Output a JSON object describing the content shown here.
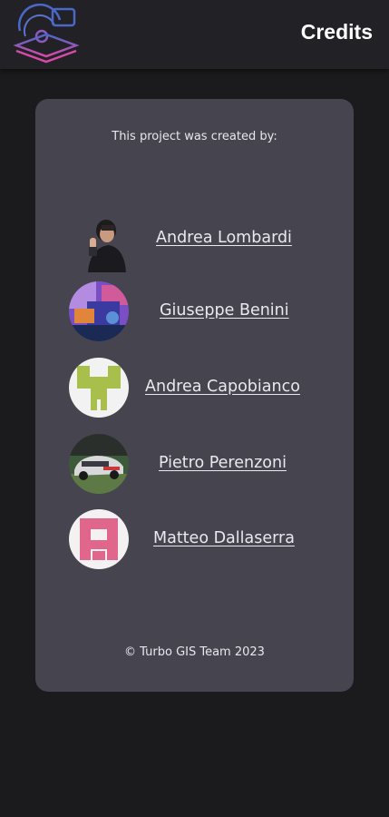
{
  "header": {
    "title": "Credits",
    "logo_icon": "turbo-gis-logo-icon"
  },
  "card": {
    "intro": "This project was created by:",
    "members": [
      {
        "name": "Andrea Lombardi",
        "avatar": "photo-avatar-icon"
      },
      {
        "name": "Giuseppe Benini",
        "avatar": "colorful-photo-avatar-icon"
      },
      {
        "name": "Andrea Capobianco",
        "avatar": "green-pixel-identicon-icon"
      },
      {
        "name": "Pietro Perenzoni",
        "avatar": "car-photo-avatar-icon"
      },
      {
        "name": "Matteo Dallaserra",
        "avatar": "pink-pixel-identicon-icon"
      }
    ],
    "footer": "© Turbo GIS Team 2023"
  },
  "colors": {
    "background": "#1b1b1d",
    "header": "#222125",
    "card": "#45444f",
    "logo_blue": "#4a68c9",
    "logo_pink": "#d84aa8",
    "identicon_green": "#a9bf4c",
    "identicon_pink": "#e0668c"
  }
}
